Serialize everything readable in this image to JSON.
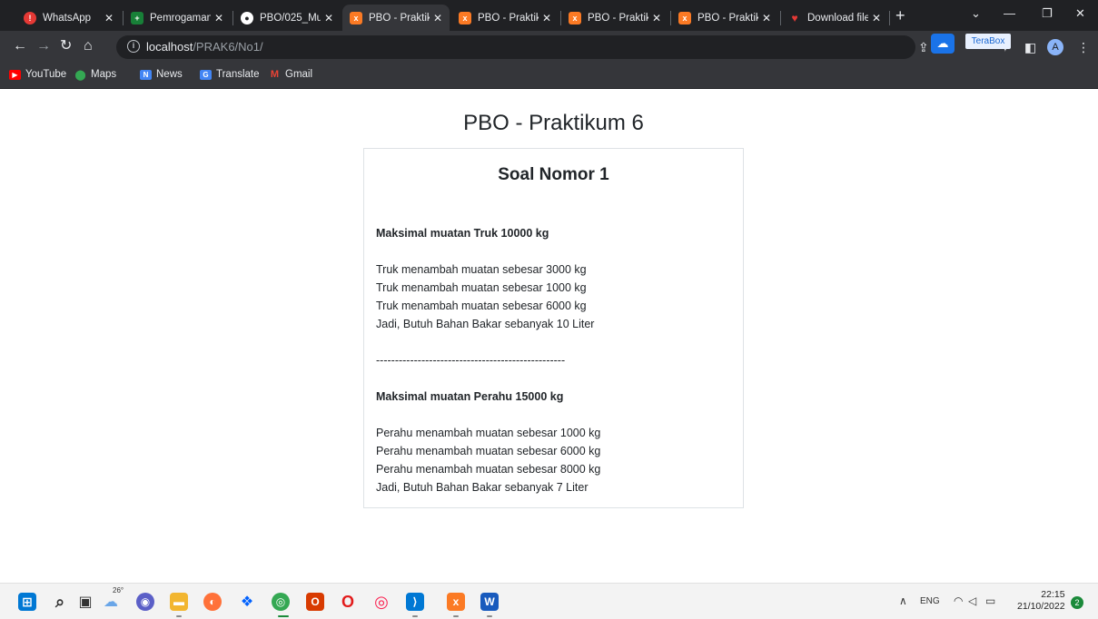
{
  "browser": {
    "tabs": [
      {
        "label": "WhatsApp",
        "icon": "whatsapp-icon",
        "color": "#e53935"
      },
      {
        "label": "Pemrogaman",
        "icon": "sheets-icon",
        "color": "#188038"
      },
      {
        "label": "PBO/025_Mu",
        "icon": "github-icon",
        "color": "#ffffff"
      },
      {
        "label": "PBO - Praktik",
        "icon": "xampp-icon",
        "color": "#fb7a24"
      },
      {
        "label": "PBO - Praktik",
        "icon": "xampp-icon",
        "color": "#fb7a24"
      },
      {
        "label": "PBO - Praktik",
        "icon": "xampp-icon",
        "color": "#fb7a24"
      },
      {
        "label": "PBO - Praktik",
        "icon": "xampp-icon",
        "color": "#fb7a24"
      },
      {
        "label": "Download file",
        "icon": "heart-icon",
        "color": "#e53935"
      }
    ],
    "active_tab_index": 3,
    "url": {
      "host": "localhost",
      "path": "/PRAK6/No1/"
    },
    "terabox_tooltip": "TeraBox",
    "profile_initial": "A",
    "bookmarks": [
      {
        "label": "YouTube",
        "icon": "youtube-icon",
        "color": "#ff0000"
      },
      {
        "label": "Maps",
        "icon": "maps-icon",
        "color": "#34a853"
      },
      {
        "label": "News",
        "icon": "news-icon",
        "color": "#4285f4"
      },
      {
        "label": "Translate",
        "icon": "translate-icon",
        "color": "#4285f4"
      },
      {
        "label": "Gmail",
        "icon": "gmail-icon",
        "color": "#ea4335"
      }
    ]
  },
  "page": {
    "title": "PBO - Praktikum 6",
    "card_title": "Soal Nomor 1",
    "lines": [
      {
        "text": "Maksimal muatan Truk 10000 kg",
        "bold": true
      },
      {
        "text": "Truk menambah muatan sebesar 3000 kg",
        "bold": false
      },
      {
        "text": "Truk menambah muatan sebesar 1000 kg",
        "bold": false
      },
      {
        "text": "Truk menambah muatan sebesar 6000 kg",
        "bold": false
      },
      {
        "text": "Jadi, Butuh Bahan Bakar sebanyak 10 Liter",
        "bold": false
      },
      {
        "text": "--------------------------------------------------",
        "bold": false
      },
      {
        "text": "Maksimal muatan Perahu 15000 kg",
        "bold": true
      },
      {
        "text": "Perahu menambah muatan sebesar 1000 kg",
        "bold": false
      },
      {
        "text": "Perahu menambah muatan sebesar 6000 kg",
        "bold": false
      },
      {
        "text": "Perahu menambah muatan sebesar 8000 kg",
        "bold": false
      },
      {
        "text": "Jadi, Butuh Bahan Bakar sebanyak 7 Liter",
        "bold": false
      }
    ]
  },
  "taskbar": {
    "weather_temp": "26°",
    "apps": [
      {
        "icon": "start-icon",
        "color": "#0078d4"
      },
      {
        "icon": "search-icon",
        "color": "#333333"
      },
      {
        "icon": "task-view-icon",
        "color": "#333333"
      },
      {
        "icon": "weather-icon",
        "color": "#6aa6e8"
      },
      {
        "icon": "chat-icon",
        "color": "#5b5fc7"
      },
      {
        "icon": "file-explorer-icon",
        "color": "#f2b630"
      },
      {
        "icon": "firefox-icon",
        "color": "#ff7139"
      },
      {
        "icon": "dropbox-icon",
        "color": "#0061fe"
      },
      {
        "icon": "chrome-icon",
        "color": "#34a853"
      },
      {
        "icon": "office-icon",
        "color": "#d83b01"
      },
      {
        "icon": "opera-icon",
        "color": "#e21b1b"
      },
      {
        "icon": "opera-gx-icon",
        "color": "#fa1e4e"
      },
      {
        "icon": "vscode-icon",
        "color": "#0078d4"
      },
      {
        "icon": "xampp-icon",
        "color": "#fb7a24"
      },
      {
        "icon": "word-icon",
        "color": "#185abd"
      }
    ],
    "tray_lang": "ENG",
    "time": "22:15",
    "date": "21/10/2022",
    "notification_count": "2"
  }
}
